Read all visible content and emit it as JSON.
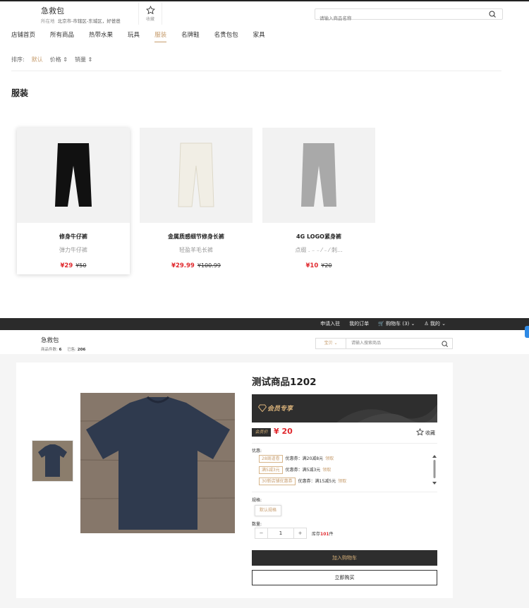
{
  "shop_header": {
    "shop_name": "急救包",
    "location_label": "所在地",
    "location": "北京市-市辖区-东城区，好爸爸",
    "favorite_label": "收藏",
    "search_placeholder": "请输入商品名称"
  },
  "nav": {
    "items": [
      "店铺首页",
      "所有商品",
      "热带水果",
      "玩具",
      "服装",
      "名牌鞋",
      "名贵包包",
      "家具"
    ],
    "active": "服装"
  },
  "sort": {
    "label": "排序:",
    "options": [
      "默认",
      "价格 ⇕",
      "销量 ⇕"
    ],
    "active": "默认"
  },
  "category_title": "服装",
  "products": [
    {
      "name": "修身牛仔裤",
      "subtitle": "弹力牛仔裤",
      "price": "¥29",
      "original_price": "¥50",
      "image_color": "#111111"
    },
    {
      "name": "金属质感细节修身长裤",
      "subtitle": "轻盈羊毛长裤",
      "price": "¥29.99",
      "original_price": "¥100.99",
      "image_color": "#efece2"
    },
    {
      "name": "4G LOGO紧身裤",
      "subtitle": "点缀 . ₋ ₋ ⁄ ₋ ⁄ 刺...",
      "price": "¥10",
      "original_price": "¥20",
      "image_color": "#a9a9a9"
    }
  ],
  "top_bar": {
    "links": [
      "申请入驻",
      "我的订单",
      "购物车 (3)",
      "我的"
    ]
  },
  "shop_header_2": {
    "shop_name": "急救包",
    "stats_goods_label": "商品件数:",
    "stats_goods": "6",
    "stats_sold_label": "已售:",
    "stats_sold": "206",
    "search_scope": "宝贝",
    "search_placeholder": "请输入搜索商品"
  },
  "detail": {
    "title": "测试商品1202",
    "vip_banner": "会员专享",
    "member_badge": "会员价",
    "price": "¥ 20",
    "favorite_label": "收藏",
    "discount_label": "优惠:",
    "coupons": [
      {
        "tag": "28周道卷",
        "desc": "优惠券：满20减8元",
        "action": "领取"
      },
      {
        "tag": "满5减3元",
        "desc": "优惠券：满5减3元",
        "action": "领取"
      },
      {
        "tag": "30新店铺优惠券",
        "desc": "优惠券：满15减5元",
        "action": "领取"
      }
    ],
    "spec_label": "规格:",
    "spec_value": "默认规格",
    "qty_label": "数量:",
    "qty_minus": "−",
    "qty_value": "1",
    "qty_plus": "+",
    "stock_label": "库存",
    "stock_value": "101",
    "stock_unit": "件",
    "add_to_cart": "加入购物车",
    "buy_now": "立即购买"
  },
  "colors": {
    "accent": "#c69c6d",
    "price_red": "#e0282d",
    "dark": "#2e2e2e",
    "gold": "#d9b27a",
    "tshirt": "#2f3a4e"
  }
}
